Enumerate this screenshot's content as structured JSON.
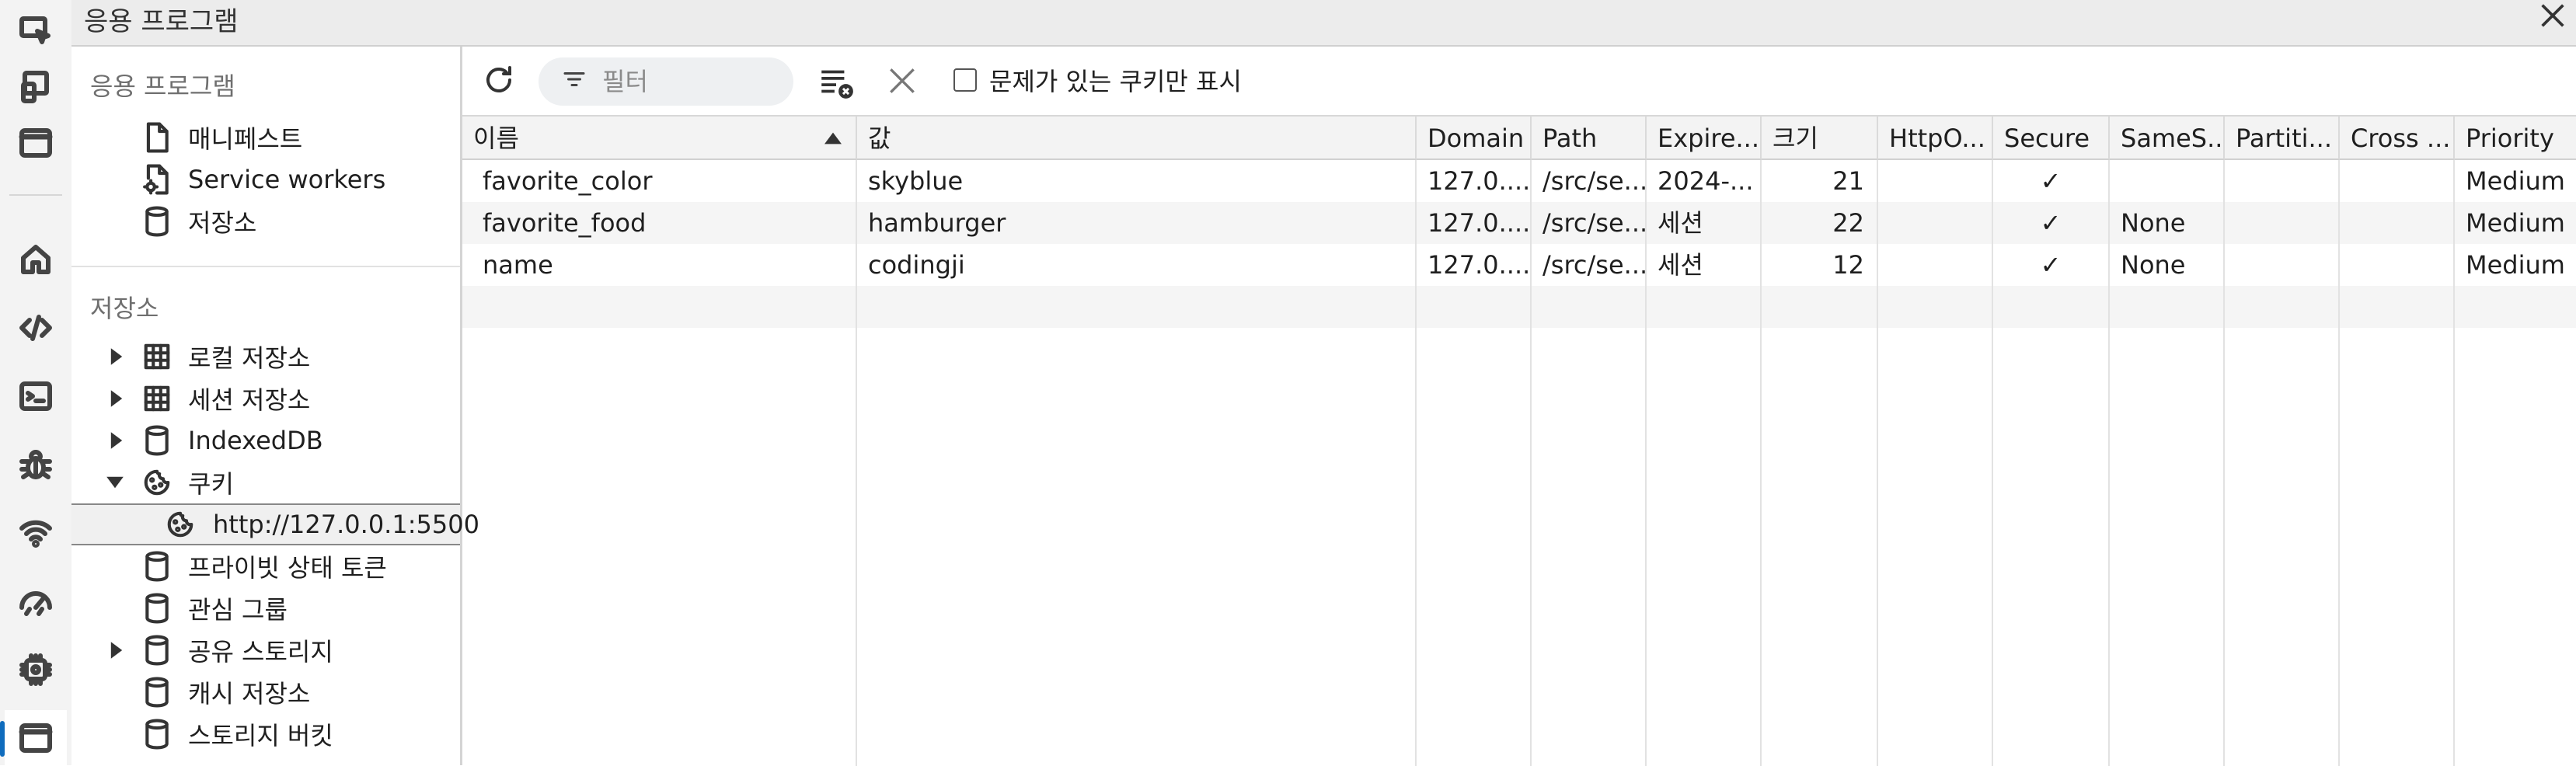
{
  "window": {
    "title": "응용 프로그램"
  },
  "sidebar": {
    "app_section": "응용 프로그램",
    "app_items": [
      {
        "label": "매니페스트",
        "icon": "document-icon"
      },
      {
        "label": "Service workers",
        "icon": "gear-document-icon"
      },
      {
        "label": "저장소",
        "icon": "database-icon"
      }
    ],
    "storage_section": "저장소",
    "storage_items": [
      {
        "label": "로컬 저장소",
        "icon": "grid-icon",
        "expandable": true
      },
      {
        "label": "세션 저장소",
        "icon": "grid-icon",
        "expandable": true
      },
      {
        "label": "IndexedDB",
        "icon": "database-icon",
        "expandable": true
      },
      {
        "label": "쿠키",
        "icon": "cookie-icon",
        "expanded": true
      },
      {
        "label": "http://127.0.0.1:5500",
        "icon": "cookie-icon",
        "selected": true
      },
      {
        "label": "프라이빗 상태 토큰",
        "icon": "database-icon"
      },
      {
        "label": "관심 그룹",
        "icon": "database-icon"
      },
      {
        "label": "공유 스토리지",
        "icon": "database-icon",
        "expandable": true
      },
      {
        "label": "캐시 저장소",
        "icon": "database-icon"
      },
      {
        "label": "스토리지 버킷",
        "icon": "database-icon"
      }
    ]
  },
  "toolbar": {
    "filter_placeholder": "필터",
    "only_issues_label": "문제가 있는 쿠키만 표시"
  },
  "table": {
    "columns": [
      "이름",
      "값",
      "Domain",
      "Path",
      "Expire...",
      "크기",
      "HttpO...",
      "Secure",
      "SameS...",
      "Partiti...",
      "Cross ...",
      "Priority"
    ],
    "rows": [
      [
        "favorite_color",
        "skyblue",
        "127.0....",
        "/src/se...",
        "2024-...",
        "21",
        "",
        "✓",
        "",
        "",
        "",
        "Medium"
      ],
      [
        "favorite_food",
        "hamburger",
        "127.0....",
        "/src/se...",
        "세션",
        "22",
        "",
        "✓",
        "None",
        "",
        "",
        "Medium"
      ],
      [
        "name",
        "codingji",
        "127.0....",
        "/src/se...",
        "세션",
        "12",
        "",
        "✓",
        "None",
        "",
        "",
        "Medium"
      ]
    ]
  },
  "colors": {
    "accent": "#0f6cbd",
    "row_alt": "#f5f5f5"
  }
}
